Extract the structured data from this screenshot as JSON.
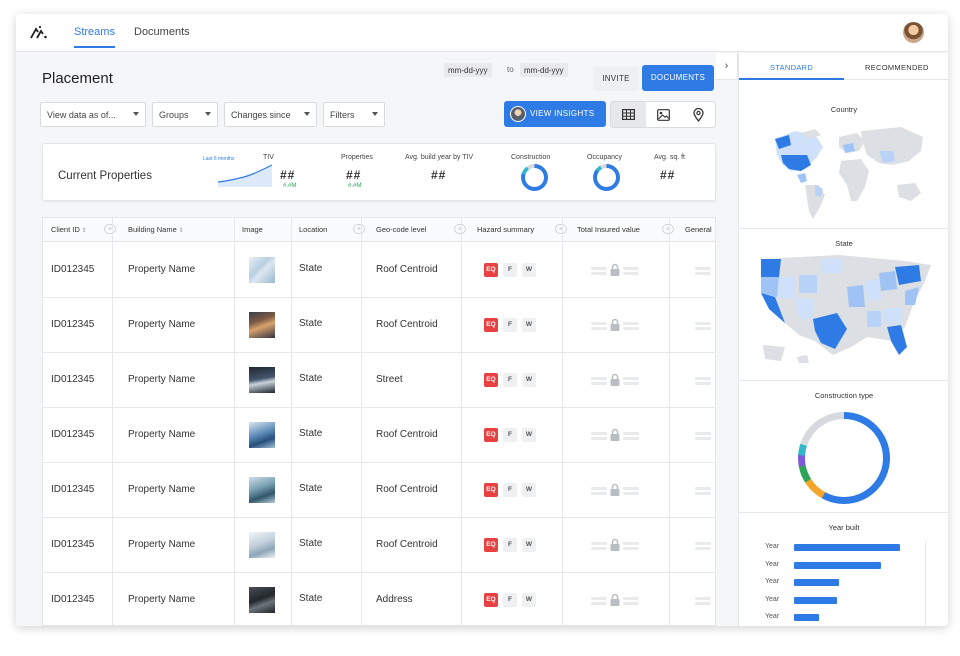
{
  "nav": {
    "tabs": [
      {
        "label": "Streams",
        "active": true
      },
      {
        "label": "Documents",
        "active": false
      }
    ]
  },
  "header": {
    "title": "Placement",
    "date_from": "mm-dd-yyy",
    "date_to_sep": "to",
    "date_to": "mm-dd-yyy",
    "invite_label": "INVITE",
    "documents_label": "DOCUMENTS"
  },
  "filters": [
    {
      "label": "View data as of..."
    },
    {
      "label": "Groups"
    },
    {
      "label": "Changes since"
    },
    {
      "label": "Filters"
    }
  ],
  "insights_label": "VIEW INSIGHTS",
  "view_modes": [
    "table-icon",
    "image-icon",
    "map-pin-icon"
  ],
  "summary": {
    "title": "Current Properties",
    "sparkline_label": "Last 6 months",
    "stats": [
      {
        "label": "TIV",
        "value": "##",
        "delta": "#.#M"
      },
      {
        "label": "Properties",
        "value": "##",
        "delta": "#.#M"
      },
      {
        "label": "Avg. build year by TIV",
        "value": "##"
      },
      {
        "label": "Construction",
        "chart": "donut"
      },
      {
        "label": "Occupancy",
        "chart": "donut"
      },
      {
        "label": "Avg. sq. ft",
        "value": "##"
      }
    ]
  },
  "table": {
    "columns": [
      "Client ID",
      "Building Name",
      "Image",
      "Location",
      "Geo-code level",
      "Hazard summary",
      "Total Insured value",
      "General"
    ],
    "hazard_badges": [
      "EQ",
      "F",
      "W"
    ],
    "rows": [
      {
        "client_id": "ID012345",
        "building": "Property Name",
        "location": "State",
        "geocode": "Roof Centroid",
        "image": "glass"
      },
      {
        "client_id": "ID012345",
        "building": "Property Name",
        "location": "State",
        "geocode": "Roof Centroid",
        "image": "warm"
      },
      {
        "client_id": "ID012345",
        "building": "Property Name",
        "location": "State",
        "geocode": "Street",
        "image": "night"
      },
      {
        "client_id": "ID012345",
        "building": "Property Name",
        "location": "State",
        "geocode": "Roof Centroid",
        "image": "blue"
      },
      {
        "client_id": "ID012345",
        "building": "Property Name",
        "location": "State",
        "geocode": "Roof Centroid",
        "image": "teal"
      },
      {
        "client_id": "ID012345",
        "building": "Property Name",
        "location": "State",
        "geocode": "Roof Centroid",
        "image": "white"
      },
      {
        "client_id": "ID012345",
        "building": "Property Name",
        "location": "State",
        "geocode": "Address",
        "image": "dark"
      }
    ]
  },
  "side_panel": {
    "tabs": [
      {
        "label": "STANDARD",
        "active": true
      },
      {
        "label": "RECOMMENDED",
        "active": false
      }
    ],
    "sections": {
      "country": "Country",
      "state": "State",
      "construction": "Construction type",
      "year_built": "Year built"
    },
    "year_built_labels": [
      "Year",
      "Year",
      "Year",
      "Year",
      "Year"
    ],
    "year_built_values": [
      0.95,
      0.78,
      0.4,
      0.38,
      0.22
    ]
  },
  "colors": {
    "accent": "#2f7be6",
    "hazard_eq": "#e94141"
  }
}
